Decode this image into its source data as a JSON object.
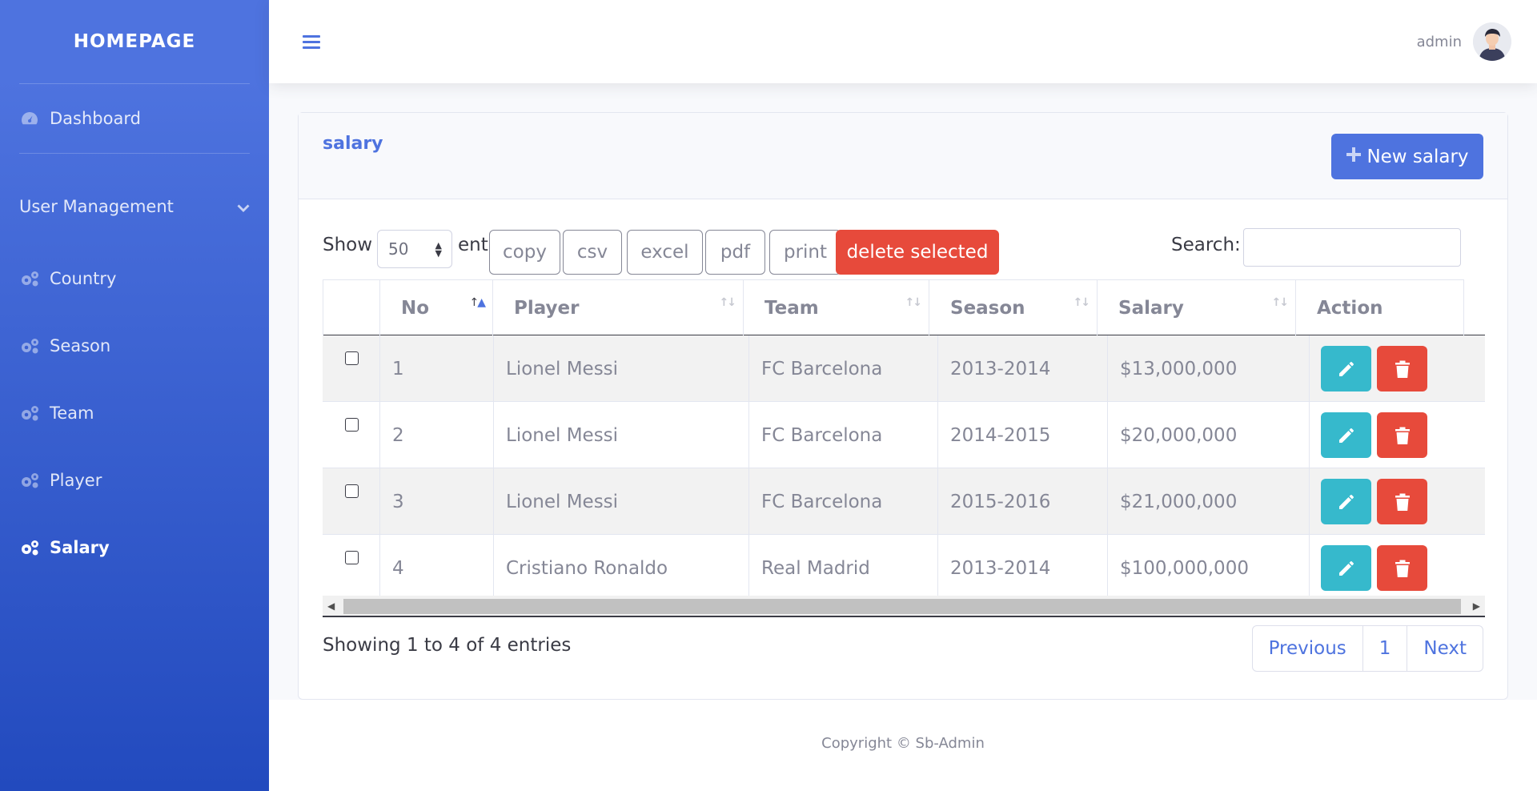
{
  "sidebar": {
    "brand": "HOMEPAGE",
    "dashboard": "Dashboard",
    "user_management": "User Management",
    "items": [
      {
        "label": "Country",
        "icon": "cogs-icon"
      },
      {
        "label": "Season",
        "icon": "cogs-icon"
      },
      {
        "label": "Team",
        "icon": "cogs-icon"
      },
      {
        "label": "Player",
        "icon": "cogs-icon"
      },
      {
        "label": "Salary",
        "icon": "cogs-icon",
        "active": true
      }
    ]
  },
  "topbar": {
    "username": "admin"
  },
  "card": {
    "title": "salary",
    "new_button": "New salary"
  },
  "controls": {
    "show_label": "Show",
    "entries_value": "50",
    "entries_label": "entries",
    "buttons": [
      "copy",
      "csv",
      "excel",
      "pdf",
      "print"
    ],
    "delete_selected": "delete selected",
    "search_label": "Search:",
    "search_value": ""
  },
  "table": {
    "columns": [
      "No",
      "Player",
      "Team",
      "Season",
      "Salary",
      "Action"
    ],
    "rows": [
      {
        "no": "1",
        "player": "Lionel Messi",
        "team": "FC Barcelona",
        "season": "2013-2014",
        "salary": "$13,000,000"
      },
      {
        "no": "2",
        "player": "Lionel Messi",
        "team": "FC Barcelona",
        "season": "2014-2015",
        "salary": "$20,000,000"
      },
      {
        "no": "3",
        "player": "Lionel Messi",
        "team": "FC Barcelona",
        "season": "2015-2016",
        "salary": "$21,000,000"
      },
      {
        "no": "4",
        "player": "Cristiano Ronaldo",
        "team": "Real Madrid",
        "season": "2013-2014",
        "salary": "$100,000,000"
      }
    ]
  },
  "pagination": {
    "info": "Showing 1 to 4 of 4 entries",
    "previous": "Previous",
    "page": "1",
    "next": "Next"
  },
  "footer": {
    "copyright": "Copyright © Sb-Admin"
  },
  "colors": {
    "primary": "#4e73df",
    "info": "#36b9cc",
    "danger": "#e74a3b"
  }
}
